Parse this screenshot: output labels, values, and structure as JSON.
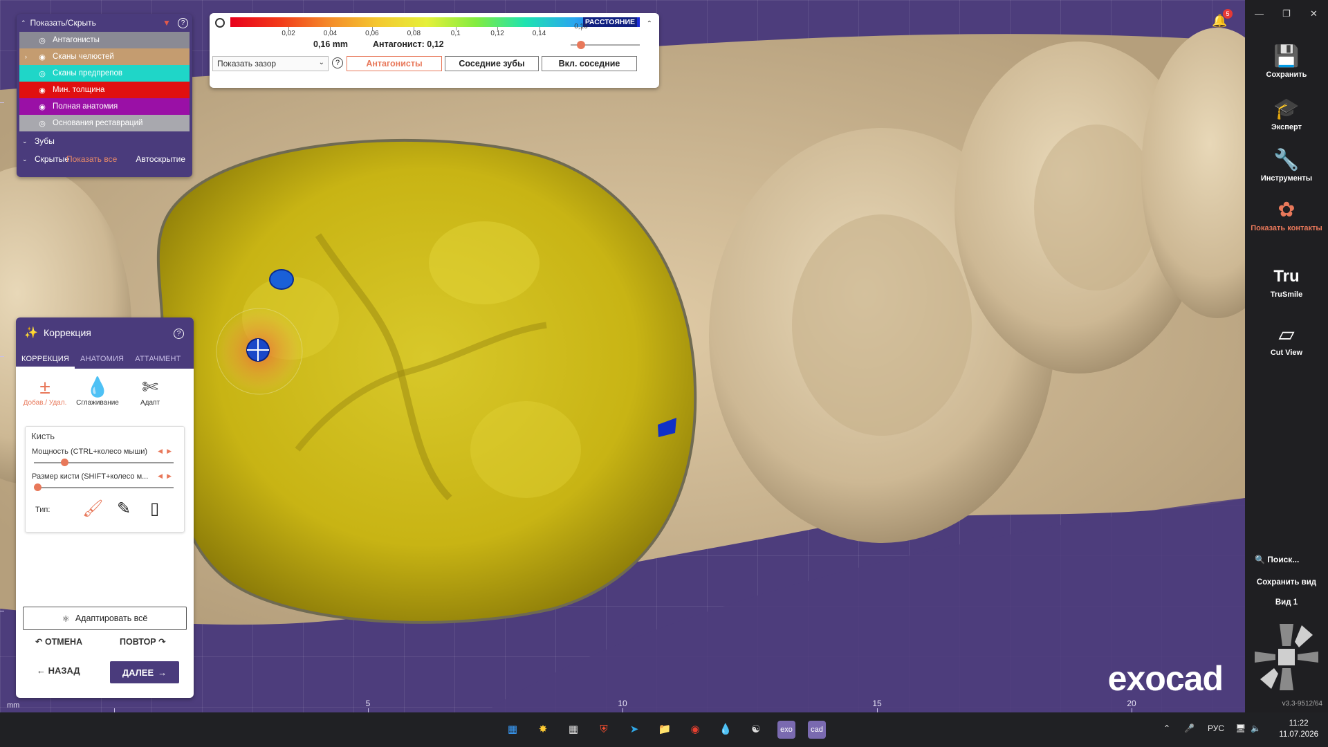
{
  "colors": {
    "panel_header": "#4a3b7c",
    "accent": "#e8785a",
    "viewport_bg": "#4d3d7c",
    "sidebar_bg": "#1f1f22",
    "tooth_highlight": "#d4c21a",
    "tooth_base": "#d2bb95"
  },
  "show_panel": {
    "title": "Показать/Скрыть",
    "layers": [
      {
        "label": "Антагонисты",
        "bg": "#8a8a94",
        "color": "#ffffff",
        "arrow": "",
        "eye": "hidden"
      },
      {
        "label": "Сканы челюстей",
        "bg": "#c49c70",
        "color": "#ffffff",
        "arrow": "›",
        "eye": "visible"
      },
      {
        "label": "Сканы предпрепов",
        "bg": "#1fd6c8",
        "color": "#ffffff",
        "arrow": "",
        "eye": "hidden"
      },
      {
        "label": "Мин. толщина",
        "bg": "#e01010",
        "color": "#ffffff",
        "arrow": "",
        "eye": "visible"
      },
      {
        "label": "Полная анатомия",
        "bg": "#9a10a6",
        "color": "#ffffff",
        "arrow": "",
        "eye": "visible"
      },
      {
        "label": "Основания реставраций",
        "bg": "#a8a8ae",
        "color": "#ffffff",
        "arrow": "",
        "eye": "hidden"
      }
    ],
    "teeth_label": "Зубы",
    "hidden_label": "Скрытые",
    "show_all_label": "Показать все",
    "auto_hide_label": "Автоскрытие"
  },
  "distance_toolbar": {
    "scale_title": "РАССТОЯНИЕ",
    "scale_ticks": [
      "0,02",
      "0,04",
      "0,06",
      "0,08",
      "0,1",
      "0,12",
      "0,14",
      "0,16"
    ],
    "current_value": "0,16 mm",
    "antagonist_label": "Антагонист: 0,12",
    "slider_fraction": 0.1,
    "mode_select": "Показать зазор",
    "buttons": [
      {
        "label": "Антагонисты",
        "active": true
      },
      {
        "label": "Соседние зубы",
        "active": false
      },
      {
        "label": "Вкл. соседние",
        "active": false
      }
    ]
  },
  "correction": {
    "title": "Коррекция",
    "tabs": [
      {
        "label": "КОРРЕКЦИЯ",
        "active": true
      },
      {
        "label": "АНАТОМИЯ",
        "active": false
      },
      {
        "label": "АТТАЧМЕНТ",
        "active": false
      }
    ],
    "tools": [
      {
        "label": "Добав./ Удал.",
        "icon": "plus-minus-icon",
        "active": true
      },
      {
        "label": "Сглаживание",
        "icon": "drop-icon",
        "active": false
      },
      {
        "label": "Адапт",
        "icon": "adapt-icon",
        "active": false
      }
    ],
    "brush_title": "Кисть",
    "strength_label": "Мощность (CTRL+колесо мыши)",
    "strength_fraction": 0.2,
    "size_label": "Размер кисти (SHIFT+колесо м...",
    "size_fraction": 0.0,
    "type_label": "Тип:",
    "adapt_all_label": "Адаптировать всё",
    "undo_label": "ОТМЕНА",
    "redo_label": "ПОВТОР",
    "back_label": "НАЗАД",
    "next_label": "ДАЛЕЕ"
  },
  "sidebar": {
    "items": [
      {
        "label": "Сохранить",
        "icon": "save-icon",
        "accent": false
      },
      {
        "label": "Эксперт",
        "icon": "graduation-cap-icon",
        "accent": false
      },
      {
        "label": "Инструменты",
        "icon": "tools-icon",
        "accent": false
      },
      {
        "label": "Показать контакты",
        "icon": "contacts-icon",
        "accent": true
      },
      {
        "label": "TruSmile",
        "icon": "trusmile-icon",
        "accent": false
      },
      {
        "label": "Cut View",
        "icon": "cut-view-icon",
        "accent": false
      }
    ],
    "search_label": "Поиск...",
    "save_view_label": "Сохранить вид",
    "view1_label": "Вид 1",
    "version": "v3.3-9512/64",
    "notifications": "5"
  },
  "viewport": {
    "ruler_unit": "mm",
    "ruler_ticks": [
      "5",
      "10",
      "15",
      "20"
    ],
    "logo": "exocad"
  },
  "taskbar": {
    "lang": "РУС",
    "time": "11:22",
    "date": "11.07.2026"
  }
}
